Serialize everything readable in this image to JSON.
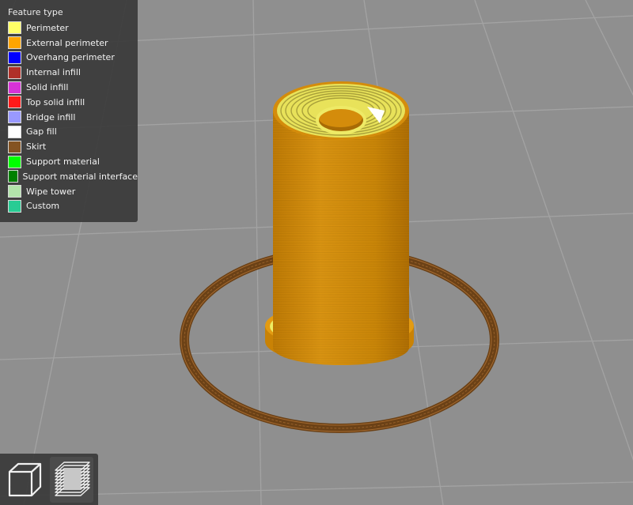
{
  "legend": {
    "title": "Feature type",
    "items": [
      {
        "label": "Perimeter",
        "color": "#ffff66"
      },
      {
        "label": "External perimeter",
        "color": "#ffa500"
      },
      {
        "label": "Overhang perimeter",
        "color": "#0000ff"
      },
      {
        "label": "Internal infill",
        "color": "#b03029"
      },
      {
        "label": "Solid infill",
        "color": "#d732d7"
      },
      {
        "label": "Top solid infill",
        "color": "#ff1a1a"
      },
      {
        "label": "Bridge infill",
        "color": "#9999ff"
      },
      {
        "label": "Gap fill",
        "color": "#ffffff"
      },
      {
        "label": "Skirt",
        "color": "#845321"
      },
      {
        "label": "Support material",
        "color": "#00ff00"
      },
      {
        "label": "Support material interface",
        "color": "#008000"
      },
      {
        "label": "Wipe tower",
        "color": "#b3e3ab"
      },
      {
        "label": "Custom",
        "color": "#28cc94"
      }
    ]
  },
  "toolbar": {
    "buttons": [
      {
        "icon": "cube-3d-view-icon"
      },
      {
        "icon": "layers-view-icon",
        "active": true
      }
    ]
  },
  "scene": {
    "background": "#8f8f8f",
    "grid_color": "#a3a3a3",
    "object_color": "#d48c0b",
    "top_perimeter_color": "#ffff66",
    "skirt_color": "#845321"
  }
}
